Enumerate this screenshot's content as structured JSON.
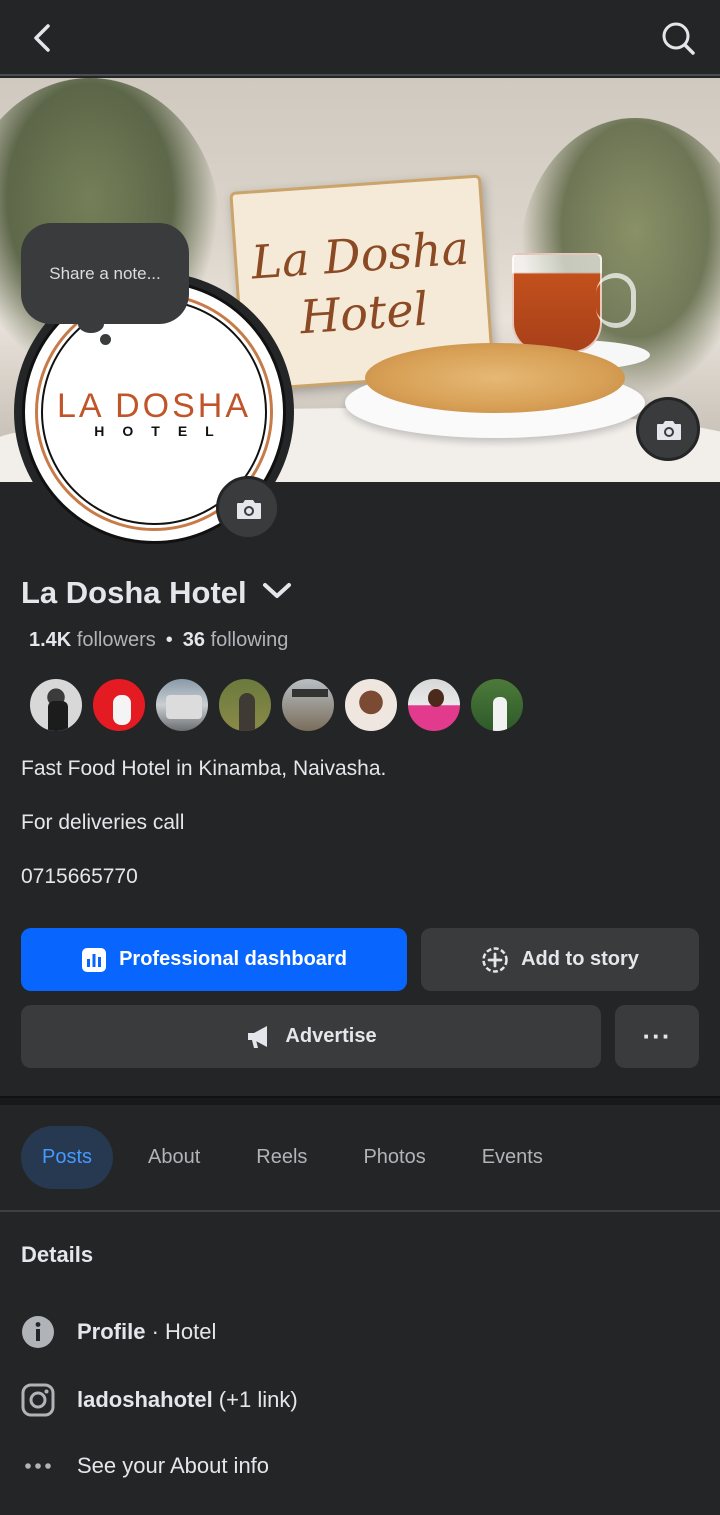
{
  "cover": {
    "sign_text_line1": "La Dosha",
    "sign_text_line2": "Hotel"
  },
  "avatar": {
    "logo_main": "LA DOSHA",
    "logo_sub": "HOTEL"
  },
  "note": {
    "placeholder": "Share a note..."
  },
  "profile": {
    "name": "La Dosha Hotel",
    "followers_count": "1.4K",
    "followers_label": "followers",
    "following_count": "36",
    "following_label": "following",
    "separator": "•"
  },
  "bio": {
    "line1": "Fast Food Hotel in Kinamba, Naivasha.",
    "line2": "For deliveries call",
    "line3": "0715665770"
  },
  "actions": {
    "primary_label": "Professional dashboard",
    "story_label": "Add to story",
    "advertise_label": "Advertise",
    "more_label": "···"
  },
  "tabs": [
    {
      "label": "Posts",
      "active": true
    },
    {
      "label": "About",
      "active": false
    },
    {
      "label": "Reels",
      "active": false
    },
    {
      "label": "Photos",
      "active": false
    },
    {
      "label": "Events",
      "active": false
    }
  ],
  "details": {
    "title": "Details",
    "profile_label": "Profile",
    "profile_value": " · Hotel",
    "instagram_handle": "ladoshahotel",
    "instagram_extra": " (+1 link)",
    "about_link": "See your About info"
  },
  "icons": {
    "back": "back-arrow-icon",
    "search": "search-icon",
    "camera": "camera-icon",
    "chevron": "chevron-down-icon",
    "dashboard": "bar-chart-icon",
    "story": "add-story-icon",
    "megaphone": "megaphone-icon",
    "info": "info-icon",
    "instagram": "instagram-icon",
    "more": "more-dots-icon"
  },
  "colors": {
    "background": "#242527",
    "primary_button": "#0866ff",
    "secondary_button": "#3a3b3c",
    "active_tab_bg": "#263951",
    "active_tab_text": "#4599ff"
  }
}
